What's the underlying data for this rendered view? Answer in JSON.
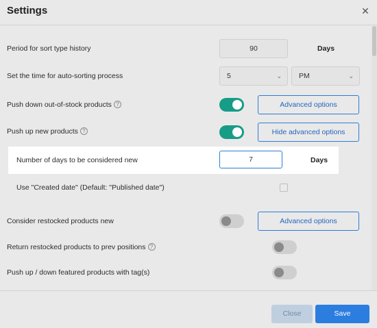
{
  "dialog": {
    "title": "Settings",
    "close_icon": "close-icon"
  },
  "rows": {
    "period": {
      "label": "Period for sort type history",
      "value": "90",
      "unit": "Days"
    },
    "autosort": {
      "label": "Set the time for auto-sorting process",
      "hour": "5",
      "ampm": "PM"
    },
    "push_down": {
      "label": "Push down out-of-stock products",
      "enabled": true,
      "button": "Advanced options"
    },
    "push_up": {
      "label": "Push up new products",
      "enabled": true,
      "button": "Hide advanced options"
    },
    "days_new": {
      "label": "Number of days to be considered new",
      "value": "7",
      "unit": "Days"
    },
    "created_date": {
      "label": "Use \"Created date\" (Default: \"Published date\")",
      "checked": false
    },
    "restocked_new": {
      "label": "Consider restocked products new",
      "enabled": false,
      "button": "Advanced options"
    },
    "return_restocked": {
      "label": "Return restocked products to prev positions",
      "enabled": false
    },
    "featured": {
      "label": "Push up / down featured products with tag(s)",
      "enabled": false
    }
  },
  "footer": {
    "close_label": "Close",
    "save_label": "Save"
  },
  "colors": {
    "toggle_on": "#179c87",
    "primary": "#2b7de0",
    "outline": "#2d7bd6"
  }
}
